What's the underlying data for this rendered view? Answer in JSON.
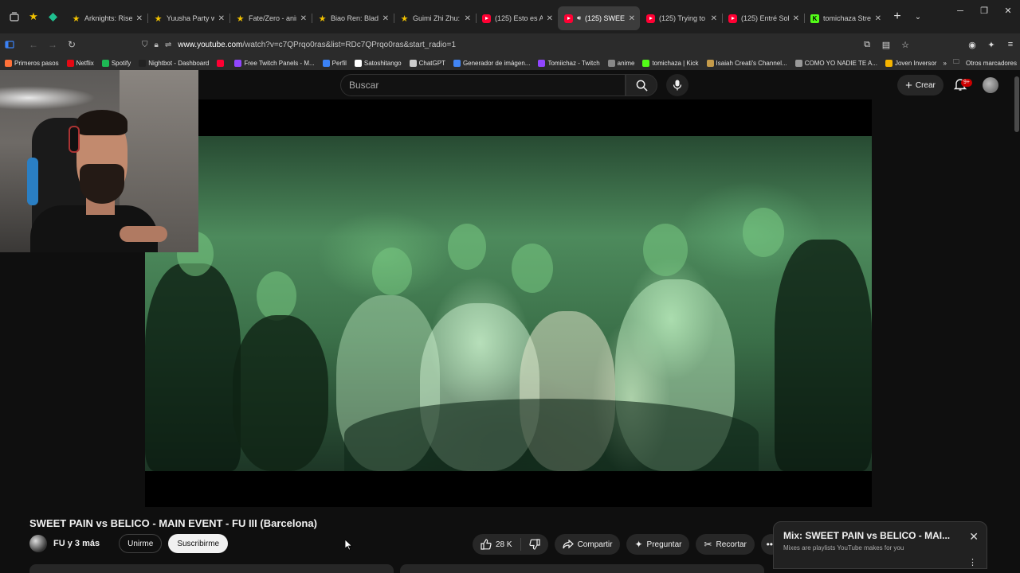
{
  "browser": {
    "tabs": [
      {
        "label": "",
        "icon": "star-icon",
        "pinned": true
      },
      {
        "label": "",
        "icon": "diamond-icon",
        "pinned": true
      },
      {
        "label": "Arknights: Rise fr",
        "icon": "star-icon"
      },
      {
        "label": "Yuusha Party wo",
        "icon": "star-icon"
      },
      {
        "label": "Fate/Zero - anime",
        "icon": "star-icon"
      },
      {
        "label": "Biao Ren: Blades c",
        "icon": "star-icon"
      },
      {
        "label": "Guimi Zhi Zhu: Xi",
        "icon": "star-icon"
      },
      {
        "label": "(125) Esto es Arge",
        "icon": "youtube-icon"
      },
      {
        "label": "(125) SWEET F",
        "icon": "youtube-icon",
        "active": true
      },
      {
        "label": "(125) Trying to be",
        "icon": "youtube-icon"
      },
      {
        "label": "(125) Entré Solo a",
        "icon": "youtube-icon"
      },
      {
        "label": "tomichaza Stream",
        "icon": "kick-icon"
      }
    ],
    "url_prefix": "www.youtube.com",
    "url_rest": "/watch?v=c7QPrqo0ras&list=RDc7QPrqo0ras&start_radio=1",
    "bookmarks": [
      {
        "label": "Primeros pasos",
        "color": "#ff7139"
      },
      {
        "label": "Netflix",
        "color": "#e50914"
      },
      {
        "label": "Spotify",
        "color": "#1db954"
      },
      {
        "label": "Nightbot - Dashboard",
        "color": "#222222"
      },
      {
        "label": "",
        "color": "#ff0033"
      },
      {
        "label": "Free Twitch Panels - M...",
        "color": "#9146ff"
      },
      {
        "label": "Perfil",
        "color": "#3b82f6"
      },
      {
        "label": "Satoshitango",
        "color": "#ffffff"
      },
      {
        "label": "ChatGPT",
        "color": "#cccccc"
      },
      {
        "label": "Generador de imágen...",
        "color": "#4285f4"
      },
      {
        "label": "Tomiichaz - Twitch",
        "color": "#9146ff"
      },
      {
        "label": "anime",
        "color": "#888888"
      },
      {
        "label": "tomichaza | Kick",
        "color": "#53fc18"
      },
      {
        "label": "Isaiah Creati's Channel...",
        "color": "#c59b4a"
      },
      {
        "label": "COMO YO NADIE TE A...",
        "color": "#999999"
      },
      {
        "label": "Joven Inversor",
        "color": "#f5b400"
      }
    ],
    "other_bookmarks": "Otros marcadores"
  },
  "youtube": {
    "search_placeholder": "Buscar",
    "create_label": "Crear",
    "notifications_badge": "9+",
    "video": {
      "title": "SWEET PAIN vs BELICO - MAIN EVENT - FU III (Barcelona)",
      "channel": "FU y 3 más",
      "join_label": "Unirme",
      "subscribe_label": "Suscribirme",
      "likes": "28 K",
      "share_label": "Compartir",
      "ask_label": "Preguntar",
      "clip_label": "Recortar"
    },
    "mix": {
      "title": "Mix: SWEET PAIN vs BELICO - MAI...",
      "subtitle": "Mixes are playlists YouTube makes for you"
    }
  },
  "colors": {
    "accent": "#ff0033",
    "background": "#0f0f0f",
    "video_tint": "#4d8a5c"
  }
}
